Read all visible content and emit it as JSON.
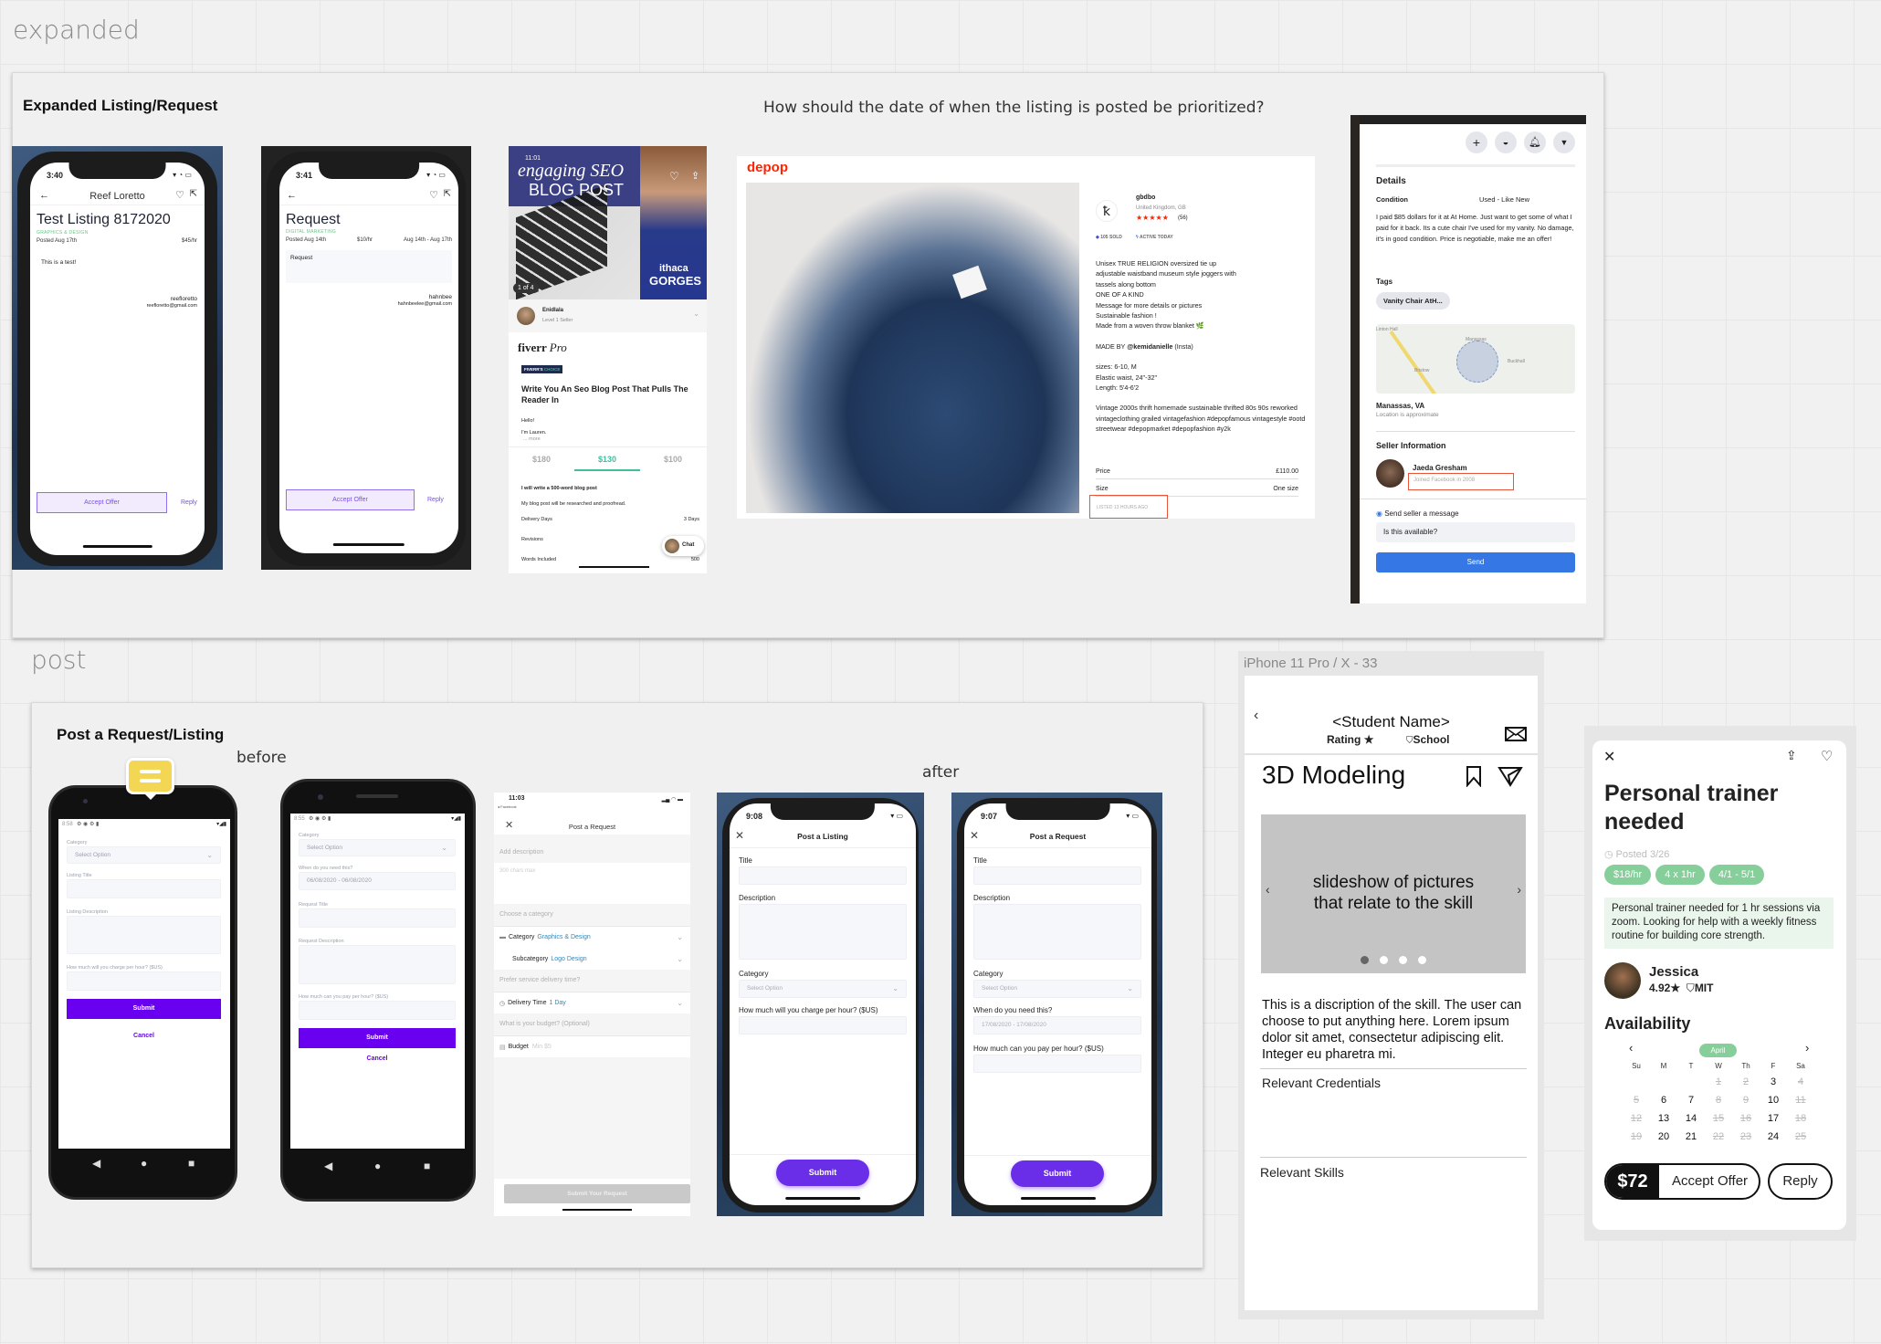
{
  "sections": {
    "expanded": "expanded",
    "post": "post"
  },
  "expanded_frame": {
    "title": "Expanded Listing/Request",
    "question": "How should the date of when the listing is posted be prioritized?"
  },
  "listing_phone": {
    "time": "3:40",
    "header": "Reef Loretto",
    "title": "Test Listing 8172020",
    "category": "GRAPHICS & DESIGN",
    "posted": "Posted Aug 17th",
    "rate": "$45/hr",
    "description": "This is a test!",
    "username": "reefloretto",
    "email": "reefloretto@gmail.com",
    "accept": "Accept Offer",
    "reply": "Reply"
  },
  "request_phone": {
    "time": "3:41",
    "title": "Request",
    "category": "DIGITAL MARKETING",
    "posted": "Posted Aug 14th",
    "rate": "$10/hr",
    "dates": "Aug 14th - Aug 17th",
    "description": "Request",
    "username": "hahnbee",
    "email": "hahnbeelee@gmail.com",
    "accept": "Accept Offer",
    "reply": "Reply"
  },
  "fiverr": {
    "time": "11:01",
    "banner_line1": "engaging SEO",
    "banner_line2": "BLOG POST",
    "shirt_line1": "ithaca",
    "shirt_line2": "GORGES",
    "counter": "1 of 4",
    "seller": "Enidlala",
    "level": "Level 1 Seller",
    "brand": "fiverr",
    "brand_pro": "Pro",
    "badge_a": "FIVERR'S",
    "badge_b": "CHOICE",
    "title": "Write You An Seo Blog Post That Pulls The Reader In",
    "intro1": "Hello!",
    "intro2": "I'm Lauren.",
    "more": "... more",
    "tiers": [
      "$180",
      "$130",
      "$100"
    ],
    "active_tier": 1,
    "package_title": "I will write a 500-word blog post",
    "package_desc": "My blog post will be researched and proofread.",
    "rows": [
      {
        "label": "Delivery Days",
        "value": "3 Days"
      },
      {
        "label": "Revisions",
        "value": ""
      },
      {
        "label": "Words Included",
        "value": "500"
      }
    ],
    "chat": "Chat",
    "accent": "#1dbf73"
  },
  "depop": {
    "logo": "depop",
    "seller": "gbdbo",
    "location": "United Kingdom, GB",
    "stars": "★★★★★",
    "reviews": "(56)",
    "sold": "105 SOLD",
    "active": "ACTIVE TODAY",
    "desc_lines": [
      "Unisex TRUE RELIGION oversized tie up",
      "adjustable waistband museum style joggers with",
      "tassels along bottom",
      "ONE OF A KIND",
      "Message for more details or pictures",
      "Sustainable fashion !",
      "Made from a woven throw blanket 🌿"
    ],
    "made_by_prefix": "MADE BY",
    "made_by_handle": "@kemidanielle",
    "made_by_suffix": "(Insta)",
    "size_lines": [
      "sizes: 6-10, M",
      "Elastic waist, 24\"-32\"",
      "Length: 5'4-6'2"
    ],
    "tags_text": "Vintage 2000s thrift homemade sustainable thrifted 80s 90s reworked vintageclothing grailed vintagefashion #depopfamous vintagestyle #ootd streetwear #depopmarket #depopfashion #y2k",
    "price_label": "Price",
    "price": "£110.00",
    "size_label": "Size",
    "size": "One size",
    "listed": "LISTED 13 HOURS AGO",
    "brand_color": "#ff2300"
  },
  "facebook": {
    "details": "Details",
    "condition_label": "Condition",
    "condition": "Used - Like New",
    "description": "I paid $85 dollars for it at At Home. Just want to get some of what I paid for it back. Its a cute chair I've used for my vanity. No damage, it's in good condition. Price is negotiable, make me an offer!",
    "tags_label": "Tags",
    "tag": "Vanity Chair AtH...",
    "map_labels": [
      "Linton Hall",
      "Manassas",
      "Bristow",
      "Buckhall"
    ],
    "city": "Manassas, VA",
    "location_note": "Location is approximate",
    "seller_info": "Seller Information",
    "seller_name": "Jaeda Gresham",
    "joined": "Joined Facebook in 2008",
    "send_label": "Send seller a message",
    "message": "Is this available?",
    "send": "Send",
    "accent": "#3578e5"
  },
  "post_frame": {
    "title": "Post a Request/Listing",
    "before": "before",
    "after": "after"
  },
  "android_listing": {
    "time": "8:58",
    "category_label": "Category",
    "select": "Select Option",
    "title_label": "Listing Title",
    "desc_label": "Listing Description",
    "rate_label": "How much will you charge per hour? ($US)",
    "submit": "Submit",
    "cancel": "Cancel"
  },
  "android_request": {
    "time": "8:55",
    "category_label": "Category",
    "select": "Select Option",
    "when_label": "When do you need this?",
    "dates": "06/08/2020 - 06/08/2020",
    "title_label": "Request Title",
    "desc_label": "Request Description",
    "rate_label": "How much can you pay per hour? ($US)",
    "submit": "Submit",
    "cancel": "Cancel"
  },
  "fiverr_post": {
    "time": "11:03",
    "carrier": "◂ Facebook",
    "title": "Post a Request",
    "desc_section": "Add description",
    "desc_placeholder": "300 chars max",
    "cat_section": "Choose a category",
    "category_label": "Category",
    "category_value": "Graphics & Design",
    "sub_label": "Subcategory",
    "sub_value": "Logo Design",
    "delivery_section": "Prefer service delivery time?",
    "delivery_label": "Delivery Time",
    "delivery_value": "1 Day",
    "budget_section": "What is your budget? (Optional)",
    "budget_label": "Budget",
    "budget_placeholder": "Min $5",
    "submit": "Submit Your Request"
  },
  "ios_listing": {
    "time": "9:08",
    "title": "Post a Listing",
    "title_label": "Title",
    "desc_label": "Description",
    "category_label": "Category",
    "select": "Select Option",
    "rate_label": "How much will you charge per hour? ($US)",
    "submit": "Submit"
  },
  "ios_request": {
    "time": "9:07",
    "title": "Post a Request",
    "title_label": "Title",
    "desc_label": "Description",
    "category_label": "Category",
    "select": "Select Option",
    "when_label": "When do you need this?",
    "dates": "17/08/2020 - 17/08/2020",
    "rate_label": "How much can you pay per hour? ($US)",
    "submit": "Submit"
  },
  "wireframe": {
    "frame_label": "iPhone 11 Pro / X - 33",
    "student": "<Student Name>",
    "rating": "Rating",
    "school": "School",
    "skill": "3D Modeling",
    "slideshow_line1": "slideshow of pictures",
    "slideshow_line2": "that relate to the skill",
    "slide_count": 4,
    "active_slide": 0,
    "description": "This is a discription of the skill. The user can choose to put anything here. Lorem ipsum dolor sit amet, consectetur adipiscing elit. Integer eu pharetra mi.",
    "credentials": "Relevant Credentials",
    "skills": "Relevant Skills"
  },
  "trainer": {
    "title": "Personal trainer needed",
    "posted": "Posted 3/26",
    "pills": [
      "$18/hr",
      "4 x 1hr",
      "4/1 - 5/1"
    ],
    "description": "Personal trainer needed for 1 hr sessions via zoom. Looking for help with a weekly fitness routine for building core strength.",
    "name": "Jessica",
    "rating": "4.92",
    "school": "MIT",
    "availability": "Availability",
    "month": "April",
    "weekdays": [
      "Su",
      "M",
      "T",
      "W",
      "Th",
      "F",
      "Sa"
    ],
    "first_weekday": 3,
    "days": [
      {
        "day": "1",
        "available": false
      },
      {
        "day": "2",
        "available": false
      },
      {
        "day": "3",
        "available": true
      },
      {
        "day": "4",
        "available": false
      },
      {
        "day": "5",
        "available": false
      },
      {
        "day": "6",
        "available": true
      },
      {
        "day": "7",
        "available": true
      },
      {
        "day": "8",
        "available": false
      },
      {
        "day": "9",
        "available": false
      },
      {
        "day": "10",
        "available": true
      },
      {
        "day": "11",
        "available": false
      },
      {
        "day": "12",
        "available": false
      },
      {
        "day": "13",
        "available": true
      },
      {
        "day": "14",
        "available": true
      },
      {
        "day": "15",
        "available": false
      },
      {
        "day": "16",
        "available": false
      },
      {
        "day": "17",
        "available": true
      },
      {
        "day": "18",
        "available": false
      },
      {
        "day": "19",
        "available": false
      },
      {
        "day": "20",
        "available": true
      },
      {
        "day": "21",
        "available": true
      },
      {
        "day": "22",
        "available": false
      },
      {
        "day": "23",
        "available": false
      },
      {
        "day": "24",
        "available": true
      },
      {
        "day": "25",
        "available": false
      }
    ],
    "price": "$72",
    "accept": "Accept Offer",
    "reply": "Reply",
    "accent": "#86cf9a"
  }
}
